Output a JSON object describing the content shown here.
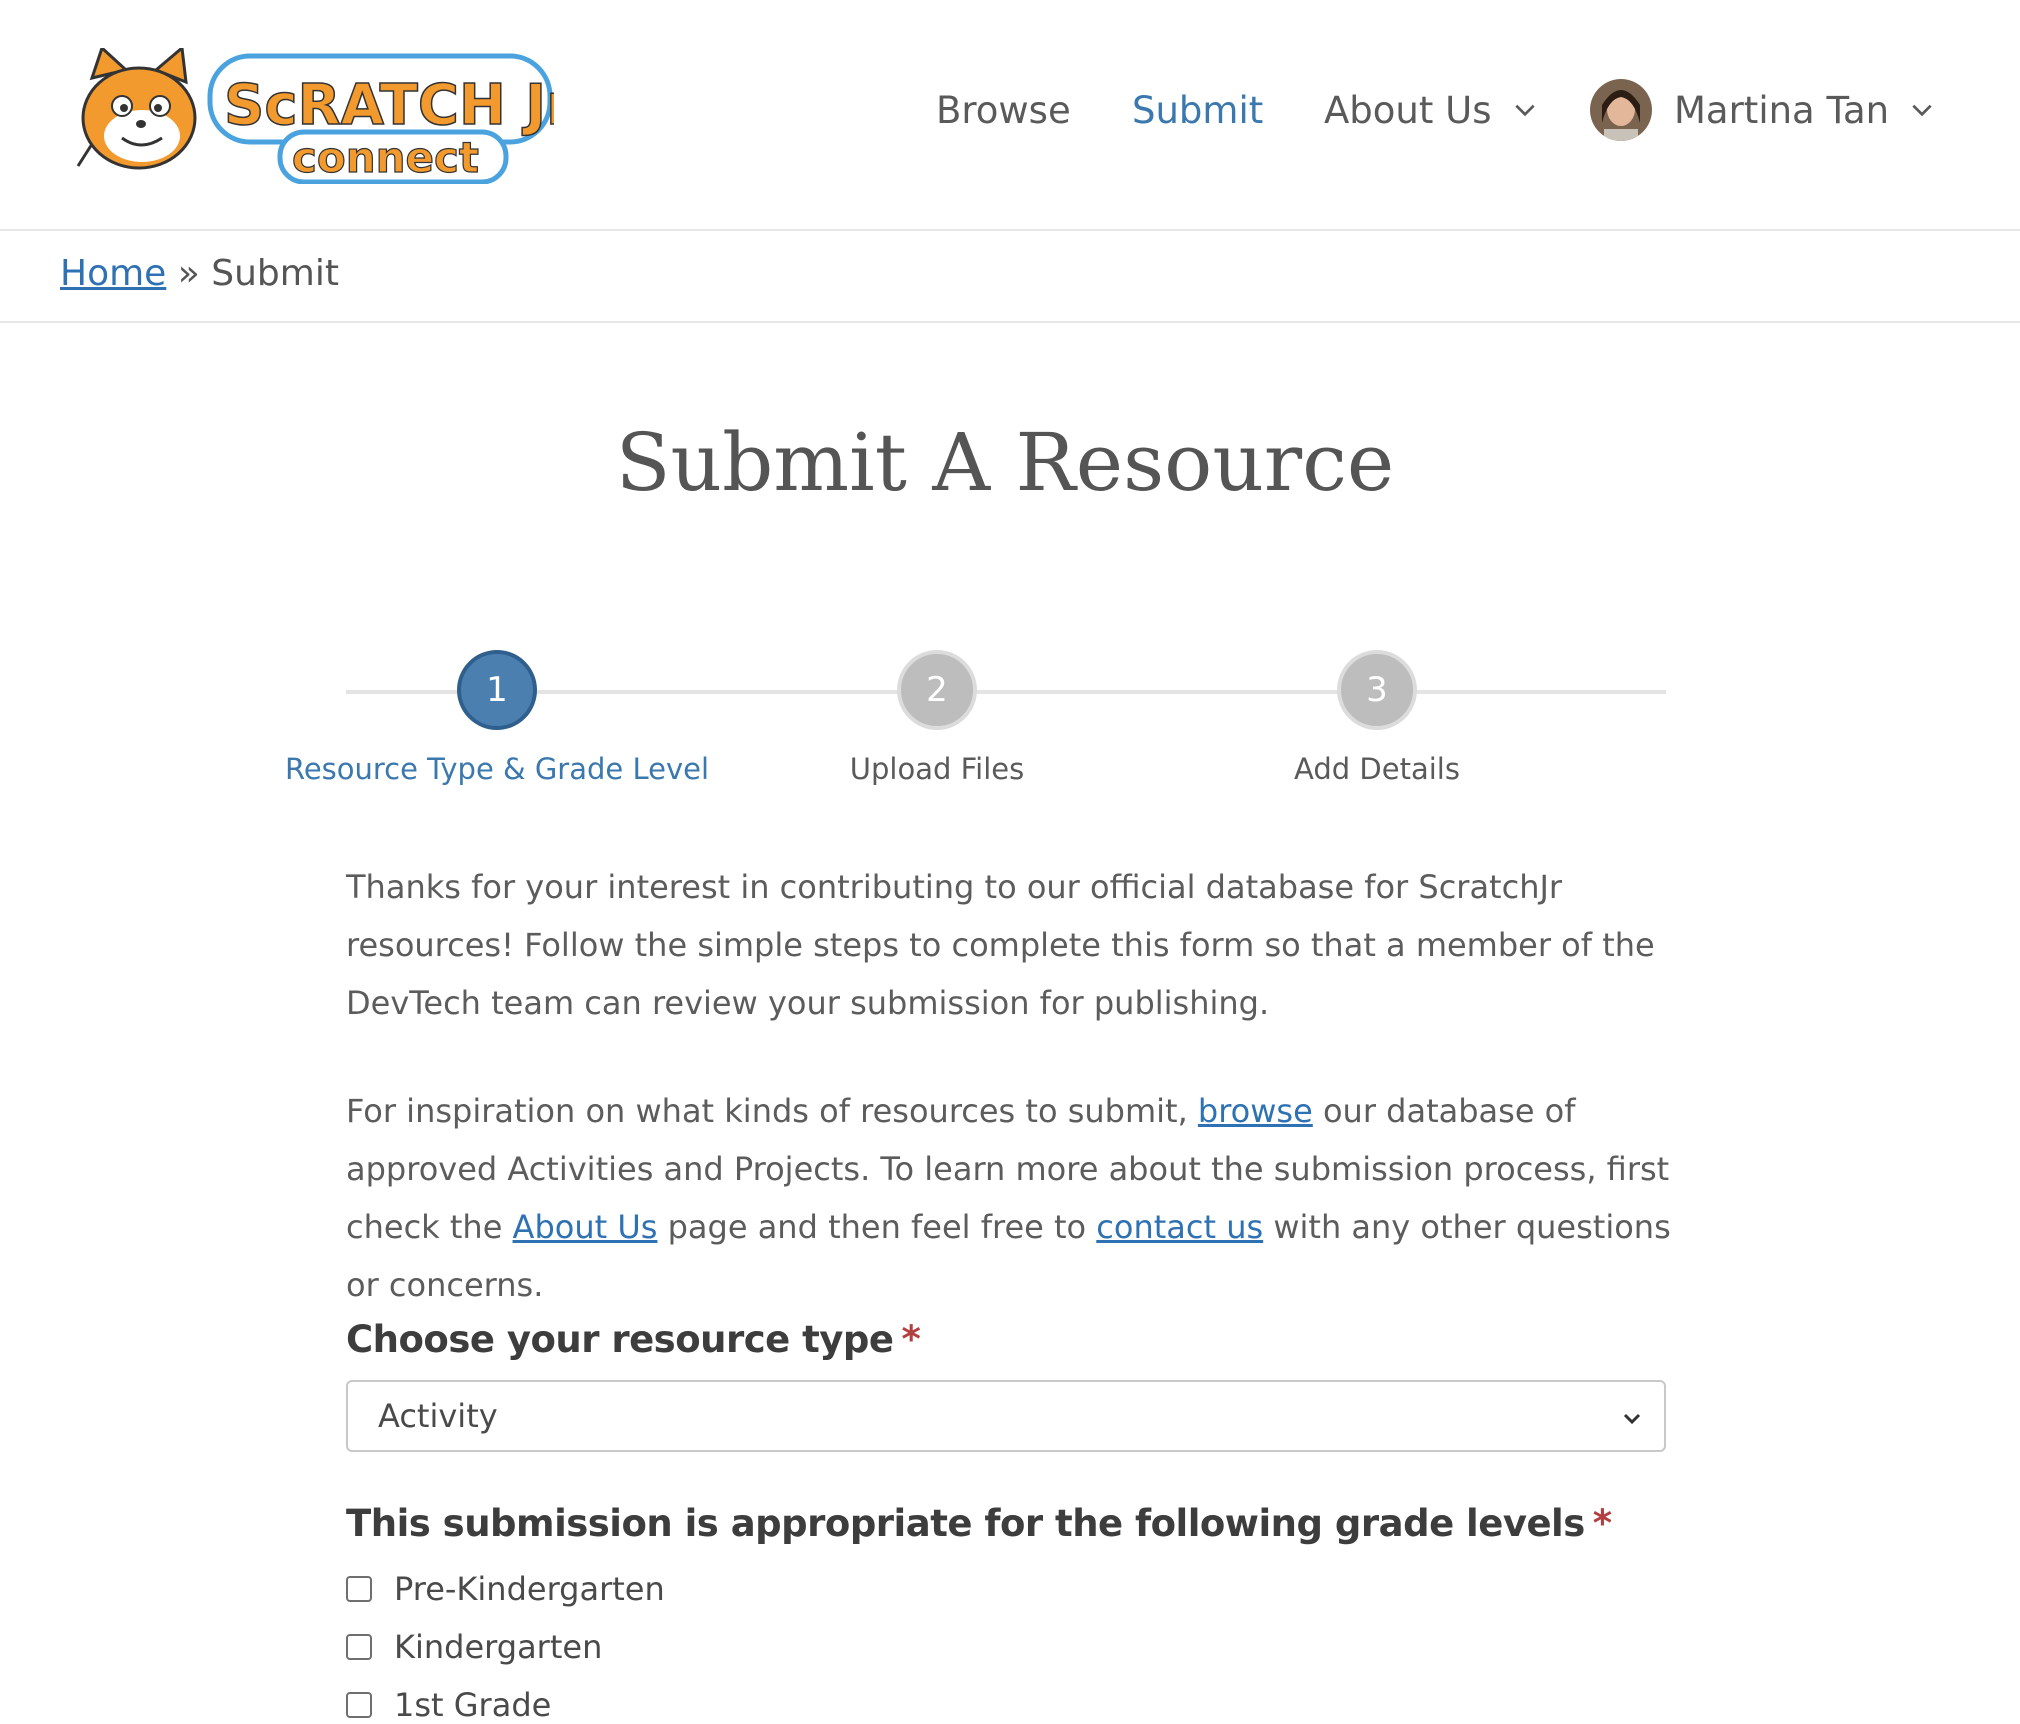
{
  "header": {
    "logo_text_top": "ScRATCH Jr",
    "logo_text_bottom": "connect",
    "nav": {
      "browse": "Browse",
      "submit": "Submit",
      "about": "About Us",
      "user": "Martina Tan"
    }
  },
  "breadcrumb": {
    "home": "Home",
    "separator": "»",
    "current": "Submit"
  },
  "page": {
    "title": "Submit A Resource"
  },
  "stepper": {
    "steps": [
      {
        "number": "1",
        "label": "Resource Type & Grade Level",
        "active": true
      },
      {
        "number": "2",
        "label": "Upload Files",
        "active": false
      },
      {
        "number": "3",
        "label": "Add Details",
        "active": false
      }
    ]
  },
  "intro": {
    "p1": "Thanks for your interest in contributing to our official database for ScratchJr resources! Follow the simple steps to complete this form so that a member of the DevTech team can review your submission for publishing.",
    "p2_a": "For inspiration on what kinds of resources to submit,",
    "p2_link_browse": "browse",
    "p2_b": "our database of approved Activities and Projects. To learn more about the submission process, first check the",
    "p2_link_about": "About Us",
    "p2_c": "page and then feel free to",
    "p2_link_contact": "contact us",
    "p2_d": "with any other questions or concerns."
  },
  "form": {
    "resource_type_label": "Choose your resource type",
    "required_mark": "*",
    "resource_type_value": "Activity",
    "grade_label": "This submission is appropriate for the following grade levels",
    "grades": [
      "Pre-Kindergarten",
      "Kindergarten",
      "1st Grade"
    ]
  },
  "colors": {
    "accent": "#3a78ad",
    "link": "#2f72b3",
    "required": "#b24040",
    "step_inactive": "#bdbdbd"
  },
  "icons": {
    "chevron": "chevron-down-icon",
    "avatar": "user-avatar"
  }
}
